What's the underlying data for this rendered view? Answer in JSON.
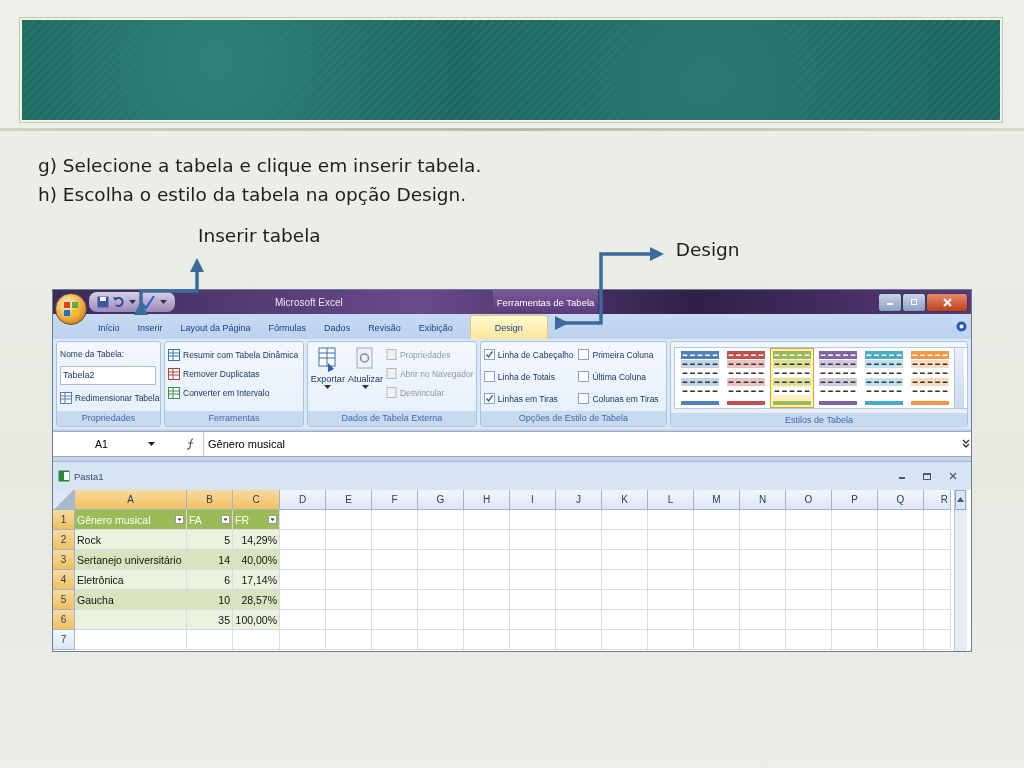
{
  "slide": {
    "instructions": [
      "g) Selecione a tabela e clique em inserir tabela.",
      "h) Escolha o estilo da tabela na opção Design."
    ],
    "callouts": [
      {
        "label": "Inserir tabela"
      },
      {
        "label": "Design"
      }
    ]
  },
  "excel": {
    "title": "Microsoft Excel",
    "context_title": "Ferramentas de Tabela",
    "tabs": [
      {
        "label": "Início",
        "selected": false
      },
      {
        "label": "Inserir",
        "selected": false
      },
      {
        "label": "Layout da Página",
        "selected": false
      },
      {
        "label": "Fórmulas",
        "selected": false
      },
      {
        "label": "Dados",
        "selected": false
      },
      {
        "label": "Revisão",
        "selected": false
      },
      {
        "label": "Exibição",
        "selected": false
      },
      {
        "label": "Design",
        "selected": true
      }
    ],
    "ribbon": {
      "properties": {
        "name_label": "Nome da Tabela:",
        "name_value": "Tabela2",
        "resize": "Redimensionar Tabela",
        "group": "Propriedades"
      },
      "tools": {
        "items": [
          "Resumir com Tabela Dinâmica",
          "Remover Duplicatas",
          "Converter em Intervalo"
        ],
        "group": "Ferramentas"
      },
      "external": {
        "export": "Exportar",
        "refresh": "Atualizar",
        "items": [
          {
            "label": "Propriedades",
            "disabled": true
          },
          {
            "label": "Abrir no Navegador",
            "disabled": true
          },
          {
            "label": "Desvincular",
            "disabled": true
          }
        ],
        "group": "Dados de Tabela Externa"
      },
      "style_options": {
        "options": [
          {
            "label": "Linha de Cabeçalho",
            "checked": true
          },
          {
            "label": "Primeira Coluna",
            "checked": false
          },
          {
            "label": "Linha de Totais",
            "checked": false
          },
          {
            "label": "Última Coluna",
            "checked": false
          },
          {
            "label": "Linhas em Tiras",
            "checked": true
          },
          {
            "label": "Colunas em Tiras",
            "checked": false
          }
        ],
        "group": "Opções de Estilo de Tabela"
      },
      "styles": {
        "swatches": [
          {
            "color": "#4f81bd",
            "selected": false
          },
          {
            "color": "#c0504d",
            "selected": false
          },
          {
            "color": "#9bbb59",
            "selected": true
          },
          {
            "color": "#8064a2",
            "selected": false
          },
          {
            "color": "#4bacc6",
            "selected": false
          },
          {
            "color": "#f79646",
            "selected": false
          }
        ],
        "group": "Estilos de Tabela"
      }
    },
    "formula_bar": {
      "cell": "A1",
      "value": "Gênero musical"
    },
    "workbook": {
      "title": "Pasta1",
      "columns": [
        "A",
        "B",
        "C",
        "D",
        "E",
        "F",
        "G",
        "H",
        "I",
        "J",
        "K",
        "L",
        "M",
        "N",
        "O",
        "P",
        "Q",
        "R"
      ],
      "rows": [
        {
          "number": "1",
          "kind": "header",
          "A": "Gênero musical",
          "B": "FA",
          "C": "FR"
        },
        {
          "number": "2",
          "kind": "data",
          "A": "Rock",
          "B": "5",
          "C": "14,29%"
        },
        {
          "number": "3",
          "kind": "data",
          "A": "Sertanejo universitário",
          "B": "14",
          "C": "40,00%"
        },
        {
          "number": "4",
          "kind": "data",
          "A": "Eletrônica",
          "B": "6",
          "C": "17,14%"
        },
        {
          "number": "5",
          "kind": "data",
          "A": "Gaucha",
          "B": "10",
          "C": "28,57%"
        },
        {
          "number": "6",
          "kind": "data",
          "B": "35",
          "C": "100,00%"
        },
        {
          "number": "7",
          "kind": "empty"
        }
      ]
    }
  }
}
